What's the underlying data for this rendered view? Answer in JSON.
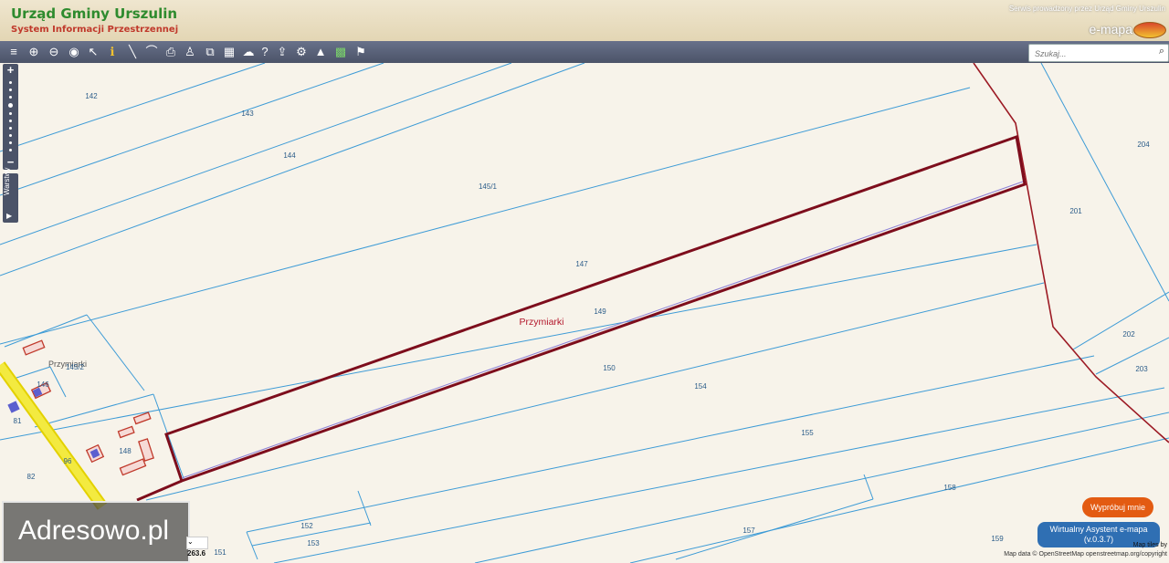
{
  "header": {
    "title": "Urząd Gminy Urszulin",
    "subtitle": "System Informacji Przestrzennej",
    "service_note": "Serwis prowadzony przez Urząd Gminy Urszulin",
    "brand": "e-mapa"
  },
  "toolbar": {
    "icons": [
      "layers-icon",
      "zoom-in-icon",
      "zoom-out-icon",
      "full-extent-icon",
      "select-arrow-icon",
      "info-icon",
      "measure-line-icon",
      "measure-area-icon",
      "print-icon",
      "street-view-icon",
      "coordinates-icon",
      "layout-icon",
      "cloud-icon",
      "help-icon",
      "upload-icon",
      "settings-icon",
      "route-icon",
      "palette-icon",
      "legend-icon"
    ]
  },
  "search": {
    "placeholder": "Szukaj..."
  },
  "sidebar": {
    "layers_label": "Warstwy"
  },
  "map": {
    "area_label": "Przymiarki",
    "village_label": "Przymiarki",
    "parcels": [
      "142",
      "143",
      "144",
      "145/1",
      "147",
      "149",
      "150",
      "154",
      "155",
      "158",
      "159",
      "157",
      "152",
      "153",
      "151",
      "148",
      "146",
      "145/2",
      "81",
      "82",
      "96",
      "201",
      "202",
      "203",
      "204"
    ],
    "scale_value": "263.6"
  },
  "colors": {
    "parcel_line": "#3d9bd6",
    "highlight": "#7d0d1c",
    "boundary": "#9c1a24",
    "road": "#f0e000",
    "map_bg": "#f7f3ea"
  },
  "watermark": {
    "text": "Adresowo.pl"
  },
  "assistant": {
    "try_label": "Wypróbuj mnie",
    "title": "Wirtualny Asystent e-mapa",
    "version": "(v.0.3.7)"
  },
  "attribution": {
    "tiles": "Map tiles by",
    "data": "Map data © OpenStreetMap openstreetmap.org/copyright"
  }
}
